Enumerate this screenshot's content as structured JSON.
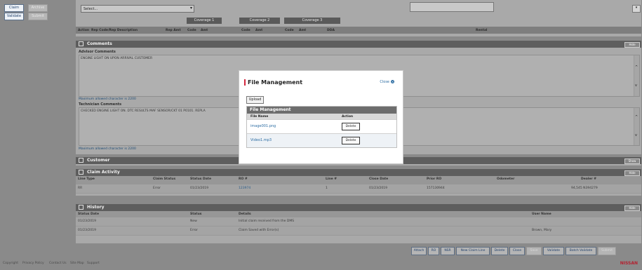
{
  "rail": {
    "claim": "Claim",
    "validate": "Validate",
    "btn3": "Archive",
    "btn4": "Submit"
  },
  "top": {
    "select_value": "Select...",
    "coverages": [
      "Coverage 1",
      "Coverage 2",
      "Coverage 3"
    ],
    "subheader": {
      "action": "Action",
      "rep_code": "Rep Code/Rep Description",
      "rep_amt": "Rep Amt",
      "code": "Code",
      "amt": "Amt",
      "dda": "DDA",
      "rental": "Rental"
    }
  },
  "comments": {
    "title": "Comments",
    "btn": "Hide",
    "advisor_label": "Advisor Comments",
    "advisor_text": "ENGINE LIGHT ON UPON ARRIVAL CUSTOMER",
    "advisor_note": "Maximum allowed character is 2200",
    "tech_label": "Technician Comments",
    "tech_text": "CHECKED ENGINE LIGHT ON. DTC RESULTS MAF SENSOR/CKT 01 P0101. REPLA",
    "tech_note": "Maximum allowed character is 2200"
  },
  "customer": {
    "title": "Customer",
    "btn": "Show"
  },
  "claim_activity": {
    "title": "Claim Activity",
    "btn": "Hide",
    "headers": [
      "Line Type",
      "Claim Status",
      "Status Date",
      "RO #",
      "Line #",
      "Close Date",
      "Prior RO",
      "Odometer",
      "Dealer #"
    ],
    "row": [
      "RR",
      "Error",
      "01/23/2019",
      "123974",
      "1",
      "01/23/2019",
      "157130944",
      "",
      "94,545  N394279"
    ]
  },
  "history": {
    "title": "History",
    "btn": "Hide",
    "headers": [
      "Status Date",
      "Status",
      "Details",
      "User Name"
    ],
    "rows": [
      [
        "01/23/2019",
        "New",
        "Initial claim received from the DMS",
        ""
      ],
      [
        "01/23/2019",
        "Error",
        "Claim Saved with Error(s)",
        "Brown, Mary"
      ]
    ]
  },
  "actions": [
    "Attach",
    "RO",
    "NSR",
    "New Claim Line",
    "Delete",
    "Close",
    "Save",
    "Validate",
    "Batch Validate",
    "Submit"
  ],
  "footer": {
    "links": [
      "Copyright",
      "Privacy Policy",
      "Contact Us",
      "Site Map",
      "Support"
    ],
    "brand": "NISSAN"
  },
  "modal": {
    "title": "File Management",
    "close": "Close",
    "upload": "Upload",
    "table_title": "File Management",
    "col_file": "File Name",
    "col_action": "Action",
    "files": [
      {
        "name": "image001.png",
        "action": "Delete"
      },
      {
        "name": "Video1.mp3",
        "action": "Delete"
      }
    ]
  }
}
